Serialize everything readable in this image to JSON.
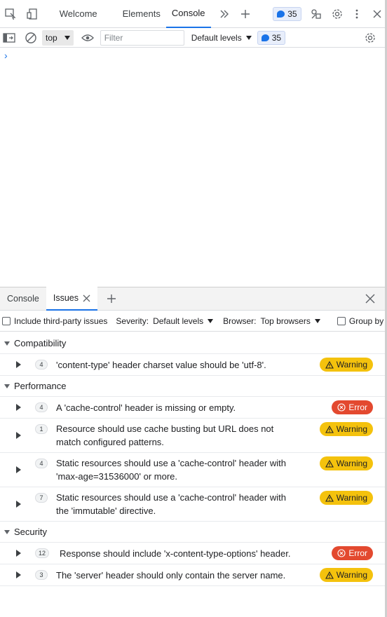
{
  "tabs": [
    {
      "label": "Welcome"
    },
    {
      "label": "Elements"
    },
    {
      "label": "Console"
    }
  ],
  "header": {
    "message_count": "35"
  },
  "console_toolbar": {
    "context": "top",
    "filter_placeholder": "Filter",
    "levels": "Default levels",
    "message_count": "35",
    "prompt": "›"
  },
  "drawer": {
    "tabs": [
      {
        "label": "Console"
      },
      {
        "label": "Issues"
      }
    ]
  },
  "issues_toolbar": {
    "third_party_label": "Include third-party issues",
    "severity_label": "Severity:",
    "severity_value": "Default levels",
    "browser_label": "Browser:",
    "browser_value": "Top browsers",
    "group_label": "Group by"
  },
  "categories": [
    {
      "name": "Compatibility",
      "issues": [
        {
          "count": "4",
          "lines": [
            "'content-type' header charset value should be 'utf-8'."
          ],
          "severity": "Warning"
        }
      ]
    },
    {
      "name": "Performance",
      "issues": [
        {
          "count": "4",
          "lines": [
            "A 'cache-control' header is missing or empty."
          ],
          "severity": "Error"
        },
        {
          "count": "1",
          "lines": [
            "Resource should use cache busting but URL does not",
            "match configured patterns."
          ],
          "severity": "Warning"
        },
        {
          "count": "4",
          "lines": [
            "Static resources should use a 'cache-control' header with",
            "'max-age=31536000' or more."
          ],
          "severity": "Warning"
        },
        {
          "count": "7",
          "lines": [
            "Static resources should use a 'cache-control' header with",
            "the 'immutable' directive."
          ],
          "severity": "Warning"
        }
      ]
    },
    {
      "name": "Security",
      "issues": [
        {
          "count": "12",
          "lines": [
            "Response should include 'x-content-type-options' header."
          ],
          "severity": "Error"
        },
        {
          "count": "3",
          "lines": [
            "The 'server' header should only contain the server name."
          ],
          "severity": "Warning"
        }
      ]
    }
  ],
  "colors": {
    "warning": "#f4c20d",
    "error": "#e3492f",
    "accent": "#1a73e8"
  }
}
